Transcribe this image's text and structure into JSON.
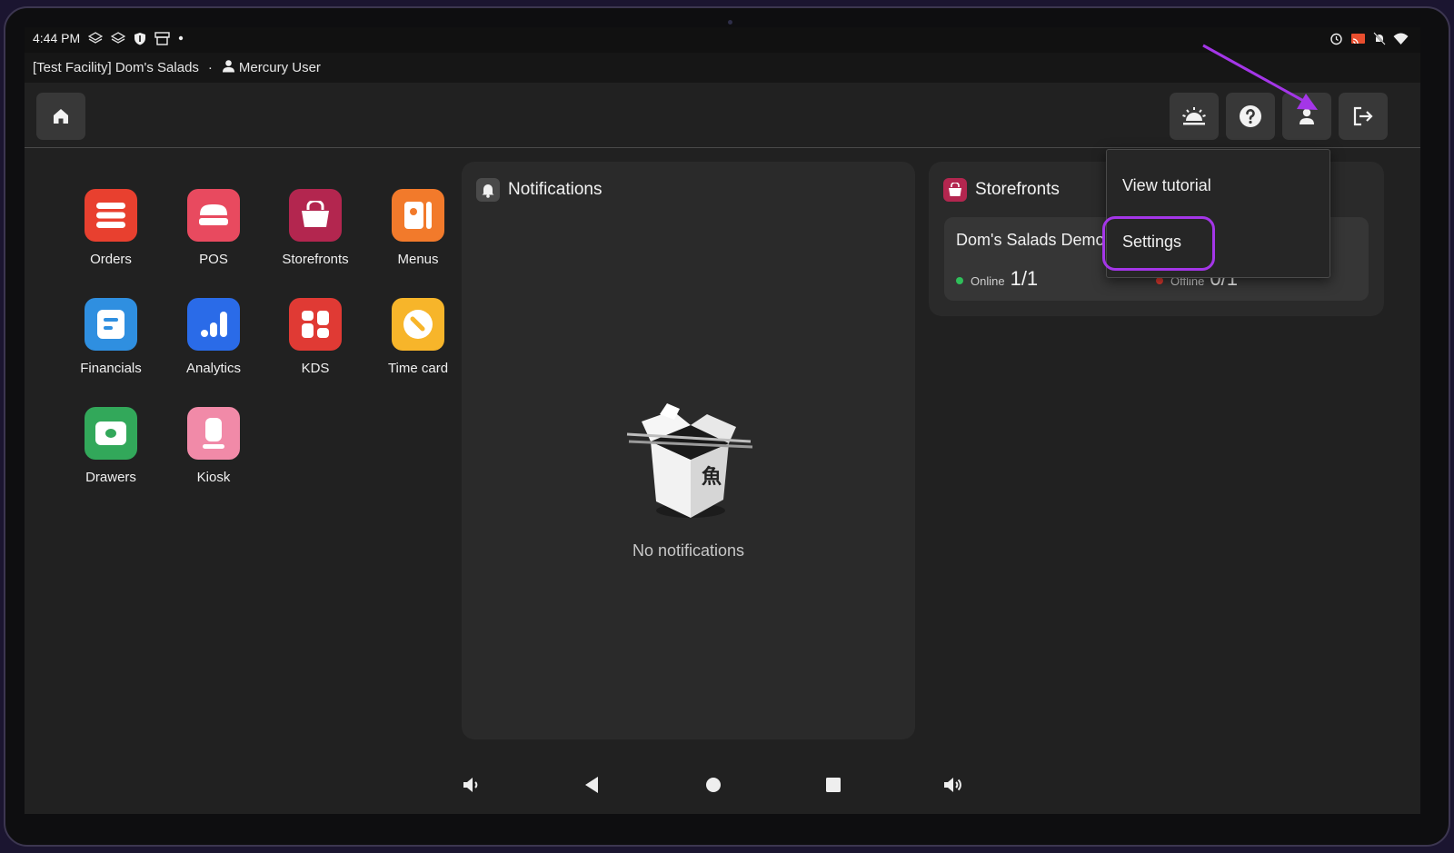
{
  "status_bar": {
    "time": "4:44 PM"
  },
  "facility_bar": {
    "facility": "[Test Facility] Dom's Salads",
    "separator": "·",
    "user": "Mercury User"
  },
  "toolbar": {
    "left": [
      "home-icon"
    ],
    "right": [
      "service-bell-icon",
      "help-icon",
      "account-icon",
      "logout-icon"
    ]
  },
  "apps": [
    {
      "label": "Orders",
      "icon": "orders-icon",
      "color": "#e8402f"
    },
    {
      "label": "POS",
      "icon": "pos-icon",
      "color": "#e84a5f"
    },
    {
      "label": "Storefronts",
      "icon": "storefronts-icon",
      "color": "#b3264f"
    },
    {
      "label": "Menus",
      "icon": "menus-icon",
      "color": "#f27a2b"
    },
    {
      "label": "Financials",
      "icon": "financials-icon",
      "color": "#2f8fe0"
    },
    {
      "label": "Analytics",
      "icon": "analytics-icon",
      "color": "#2a6be8"
    },
    {
      "label": "KDS",
      "icon": "kds-icon",
      "color": "#e03a34"
    },
    {
      "label": "Time card",
      "icon": "time-card-icon",
      "color": "#f7b52a"
    },
    {
      "label": "Drawers",
      "icon": "drawers-icon",
      "color": "#32a85a"
    },
    {
      "label": "Kiosk",
      "icon": "kiosk-icon",
      "color": "#f18aa8"
    }
  ],
  "notifications": {
    "title": "Notifications",
    "empty_text": "No notifications"
  },
  "storefronts": {
    "title": "Storefronts",
    "card": {
      "name": "Dom's Salads Demo",
      "online_label": "Online",
      "online_value": "1/1",
      "offline_label": "Offline",
      "offline_value": "0/1"
    }
  },
  "account_menu": {
    "items": [
      "View tutorial",
      "Settings"
    ]
  },
  "colors": {
    "accent_annotation": "#a436e8",
    "online": "#2fbf5a",
    "offline": "#e03a2f"
  }
}
